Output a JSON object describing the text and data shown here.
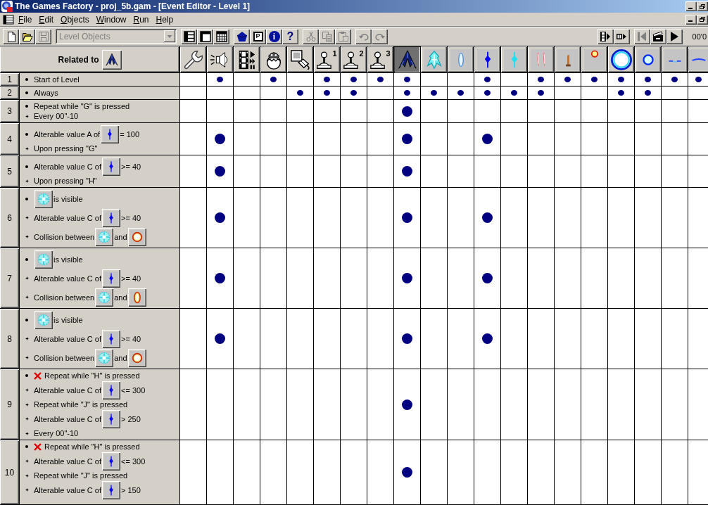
{
  "window": {
    "title": "The Games Factory - proj_5b.gam - [Event Editor - Level 1]"
  },
  "menu": [
    "File",
    "Edit",
    "Objects",
    "Window",
    "Run",
    "Help"
  ],
  "toolbar": {
    "left": [
      [
        {
          "kind": "new",
          "disabled": false
        },
        {
          "kind": "open",
          "disabled": false
        },
        {
          "kind": "save",
          "disabled": true
        }
      ],
      [
        {
          "kind": "dropdown",
          "value": "Level Objects",
          "disabled": true
        }
      ],
      [
        {
          "kind": "rows",
          "disabled": false
        },
        {
          "kind": "panes",
          "disabled": false
        },
        {
          "kind": "grid",
          "disabled": false
        }
      ],
      [
        {
          "kind": "object",
          "disabled": false
        },
        {
          "kind": "properties",
          "label": "P",
          "disabled": false
        },
        {
          "kind": "info",
          "label": "i",
          "disabled": false
        },
        {
          "kind": "help",
          "label": "?",
          "disabled": false
        }
      ],
      [
        {
          "kind": "cut",
          "disabled": true
        },
        {
          "kind": "copy",
          "disabled": true
        },
        {
          "kind": "paste",
          "disabled": true
        }
      ],
      [
        {
          "kind": "undo",
          "disabled": true
        },
        {
          "kind": "redo",
          "disabled": true
        }
      ]
    ],
    "right": [
      [
        {
          "kind": "filmplay",
          "disabled": false
        },
        {
          "kind": "filmstep",
          "disabled": false
        }
      ],
      [
        {
          "kind": "rewind",
          "disabled": true
        },
        {
          "kind": "clapper",
          "disabled": false
        },
        {
          "kind": "play",
          "disabled": false
        }
      ]
    ],
    "counter": "00'0"
  },
  "header": {
    "label": "Related to",
    "related_object": {
      "kind": "ship"
    },
    "columns": [
      {
        "kind": "wrench",
        "selected": false
      },
      {
        "kind": "speaker",
        "selected": false
      },
      {
        "kind": "film",
        "selected": false
      },
      {
        "kind": "egg",
        "selected": false
      },
      {
        "kind": "keymouse",
        "selected": false
      },
      {
        "kind": "joystick",
        "label": "1",
        "selected": false
      },
      {
        "kind": "joystick",
        "label": "2",
        "selected": false
      },
      {
        "kind": "joystick",
        "label": "3",
        "selected": false
      },
      {
        "kind": "ship",
        "selected": true
      },
      {
        "kind": "sprite",
        "selected": false
      },
      {
        "kind": "capsule",
        "selected": false
      },
      {
        "kind": "diamond",
        "selected": false
      },
      {
        "kind": "crystal",
        "selected": false
      },
      {
        "kind": "flames",
        "selected": false
      },
      {
        "kind": "stick",
        "selected": false
      },
      {
        "kind": "spark",
        "selected": false
      },
      {
        "kind": "halo",
        "selected": false
      },
      {
        "kind": "bubble",
        "selected": false
      },
      {
        "kind": "dash",
        "selected": false
      },
      {
        "kind": "arc",
        "selected": false
      }
    ]
  },
  "rows": [
    {
      "number": "1",
      "conditions": [
        {
          "negated": false,
          "parts": [
            {
              "kind": "text",
              "text": "Start of Level"
            }
          ]
        }
      ],
      "marks": [
        false,
        true,
        false,
        true,
        false,
        true,
        true,
        true,
        true,
        false,
        false,
        true,
        false,
        true,
        true,
        true,
        true,
        true,
        true,
        true
      ]
    },
    {
      "number": "2",
      "conditions": [
        {
          "negated": false,
          "parts": [
            {
              "kind": "text",
              "text": "Always"
            }
          ]
        }
      ],
      "marks": [
        false,
        false,
        false,
        false,
        true,
        true,
        true,
        false,
        true,
        true,
        true,
        true,
        true,
        true,
        false,
        false,
        true,
        true,
        false,
        false
      ]
    },
    {
      "number": "3",
      "conditions": [
        {
          "negated": false,
          "parts": [
            {
              "kind": "text",
              "text": "Repeat while \"G\" is pressed"
            }
          ]
        },
        {
          "negated": false,
          "parts": [
            {
              "kind": "text",
              "text": "Every 00\"-10"
            }
          ]
        }
      ],
      "marks": [
        false,
        false,
        false,
        false,
        false,
        false,
        false,
        false,
        true,
        false,
        false,
        false,
        false,
        false,
        false,
        false,
        false,
        false,
        false,
        false
      ]
    },
    {
      "number": "4",
      "conditions": [
        {
          "negated": false,
          "parts": [
            {
              "kind": "text",
              "text": "Alterable value A of"
            },
            {
              "kind": "diamond"
            },
            {
              "kind": "text",
              "text": "= 100"
            }
          ]
        },
        {
          "negated": false,
          "parts": [
            {
              "kind": "text",
              "text": "Upon pressing \"G\""
            }
          ]
        }
      ],
      "marks": [
        false,
        true,
        false,
        false,
        false,
        false,
        false,
        false,
        true,
        false,
        false,
        true,
        false,
        false,
        false,
        false,
        false,
        false,
        false,
        false
      ]
    },
    {
      "number": "5",
      "conditions": [
        {
          "negated": false,
          "parts": [
            {
              "kind": "text",
              "text": "Alterable value C of"
            },
            {
              "kind": "diamond"
            },
            {
              "kind": "text",
              "text": ">= 40"
            }
          ]
        },
        {
          "negated": false,
          "parts": [
            {
              "kind": "text",
              "text": "Upon pressing \"H\""
            }
          ]
        }
      ],
      "marks": [
        false,
        true,
        false,
        false,
        false,
        false,
        false,
        false,
        true,
        false,
        false,
        false,
        false,
        false,
        false,
        false,
        false,
        false,
        false,
        false
      ]
    },
    {
      "number": "6",
      "conditions": [
        {
          "negated": false,
          "parts": [
            {
              "kind": "sprite"
            },
            {
              "kind": "text",
              "text": "is visible"
            }
          ]
        },
        {
          "negated": false,
          "parts": [
            {
              "kind": "text",
              "text": "Alterable value C of"
            },
            {
              "kind": "diamond"
            },
            {
              "kind": "text",
              "text": ">= 40"
            }
          ]
        },
        {
          "negated": false,
          "parts": [
            {
              "kind": "text",
              "text": "Collision between"
            },
            {
              "kind": "sprite"
            },
            {
              "kind": "text",
              "text": "and"
            },
            {
              "kind": "ring"
            }
          ]
        }
      ],
      "marks": [
        false,
        true,
        false,
        false,
        false,
        false,
        false,
        false,
        true,
        false,
        false,
        true,
        false,
        false,
        false,
        false,
        false,
        false,
        false,
        false
      ]
    },
    {
      "number": "7",
      "conditions": [
        {
          "negated": false,
          "parts": [
            {
              "kind": "sprite"
            },
            {
              "kind": "text",
              "text": "is visible"
            }
          ]
        },
        {
          "negated": false,
          "parts": [
            {
              "kind": "text",
              "text": "Alterable value C of"
            },
            {
              "kind": "diamond"
            },
            {
              "kind": "text",
              "text": ">= 40"
            }
          ]
        },
        {
          "negated": false,
          "parts": [
            {
              "kind": "text",
              "text": "Collision between"
            },
            {
              "kind": "sprite"
            },
            {
              "kind": "text",
              "text": "and"
            },
            {
              "kind": "oval"
            }
          ]
        }
      ],
      "marks": [
        false,
        true,
        false,
        false,
        false,
        false,
        false,
        false,
        true,
        false,
        false,
        true,
        false,
        false,
        false,
        false,
        false,
        false,
        false,
        false
      ]
    },
    {
      "number": "8",
      "conditions": [
        {
          "negated": false,
          "parts": [
            {
              "kind": "sprite"
            },
            {
              "kind": "text",
              "text": "is visible"
            }
          ]
        },
        {
          "negated": false,
          "parts": [
            {
              "kind": "text",
              "text": "Alterable value C of"
            },
            {
              "kind": "diamond"
            },
            {
              "kind": "text",
              "text": ">= 40"
            }
          ]
        },
        {
          "negated": false,
          "parts": [
            {
              "kind": "text",
              "text": "Collision between"
            },
            {
              "kind": "sprite"
            },
            {
              "kind": "text",
              "text": "and"
            },
            {
              "kind": "ring"
            }
          ]
        }
      ],
      "marks": [
        false,
        true,
        false,
        false,
        false,
        false,
        false,
        false,
        true,
        false,
        false,
        true,
        false,
        false,
        false,
        false,
        false,
        false,
        false,
        false
      ]
    },
    {
      "number": "9",
      "conditions": [
        {
          "negated": true,
          "parts": [
            {
              "kind": "text",
              "text": "Repeat while \"H\" is pressed"
            }
          ]
        },
        {
          "negated": false,
          "parts": [
            {
              "kind": "text",
              "text": "Alterable value C of"
            },
            {
              "kind": "diamond"
            },
            {
              "kind": "text",
              "text": "<= 300"
            }
          ]
        },
        {
          "negated": false,
          "parts": [
            {
              "kind": "text",
              "text": "Repeat while \"J\" is pressed"
            }
          ]
        },
        {
          "negated": false,
          "parts": [
            {
              "kind": "text",
              "text": "Alterable value C of"
            },
            {
              "kind": "diamond"
            },
            {
              "kind": "text",
              "text": "> 250"
            }
          ]
        },
        {
          "negated": false,
          "parts": [
            {
              "kind": "text",
              "text": "Every 00\"-10"
            }
          ]
        }
      ],
      "marks": [
        false,
        false,
        false,
        false,
        false,
        false,
        false,
        false,
        true,
        false,
        false,
        false,
        false,
        false,
        false,
        false,
        false,
        false,
        false,
        false
      ]
    },
    {
      "number": "10",
      "conditions": [
        {
          "negated": true,
          "parts": [
            {
              "kind": "text",
              "text": "Repeat while \"H\" is pressed"
            }
          ]
        },
        {
          "negated": false,
          "parts": [
            {
              "kind": "text",
              "text": "Alterable value C of"
            },
            {
              "kind": "diamond"
            },
            {
              "kind": "text",
              "text": "<= 300"
            }
          ]
        },
        {
          "negated": false,
          "parts": [
            {
              "kind": "text",
              "text": "Repeat while \"J\" is pressed"
            }
          ]
        },
        {
          "negated": false,
          "parts": [
            {
              "kind": "text",
              "text": "Alterable value C of"
            },
            {
              "kind": "diamond"
            },
            {
              "kind": "text",
              "text": "> 150"
            }
          ]
        }
      ],
      "marks": [
        false,
        false,
        false,
        false,
        false,
        false,
        false,
        false,
        true,
        false,
        false,
        false,
        false,
        false,
        false,
        false,
        false,
        false,
        false,
        false
      ]
    }
  ]
}
